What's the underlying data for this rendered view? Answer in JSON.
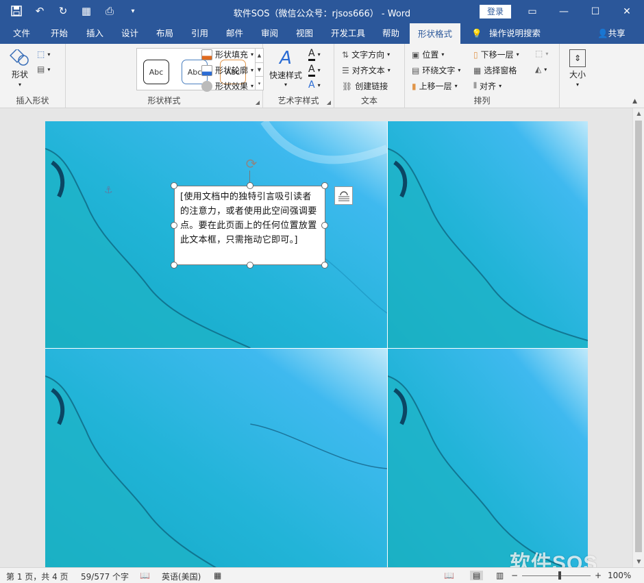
{
  "window": {
    "title": "软件SOS（微信公众号：rjsos666） - Word",
    "login_label": "登录"
  },
  "tabs": [
    "文件",
    "开始",
    "插入",
    "设计",
    "布局",
    "引用",
    "邮件",
    "审阅",
    "视图",
    "开发工具",
    "帮助",
    "形状格式"
  ],
  "active_tab": "形状格式",
  "tell_me": "操作说明搜索",
  "share": "共享",
  "ribbon": {
    "insert_shape": {
      "shape_label": "形状",
      "group_label": "插入形状"
    },
    "shape_styles": {
      "abc1": "Abc",
      "abc2": "Abc",
      "abc3": "Abc",
      "fill": "形状填充",
      "outline": "形状轮廓",
      "effect": "形状效果",
      "group_label": "形状样式"
    },
    "wordart": {
      "quick_styles": "快速样式",
      "group_label": "艺术字样式"
    },
    "text": {
      "direction": "文字方向",
      "align": "对齐文本",
      "link": "创建链接",
      "group_label": "文本"
    },
    "arrange": {
      "position": "位置",
      "wrap": "环绕文字",
      "bring_forward": "上移一层",
      "send_backward": "下移一层",
      "selection_pane": "选择窗格",
      "align": "对齐",
      "group_label": "排列"
    },
    "size": {
      "label": "大小"
    }
  },
  "document": {
    "textbox_text": "[使用文档中的独特引言吸引读者的注意力，或者使用此空间强调要点。要在此页面上的任何位置放置此文本框，只需拖动它即可。]"
  },
  "status": {
    "page": "第 1 页，共 4 页",
    "words": "59/577 个字",
    "language": "英语(美国)",
    "zoom": "100%"
  },
  "watermark": "软件SOS",
  "colors": {
    "brand": "#2b579a",
    "ribbon_bg": "#f3f3f3",
    "abc_border1": "#222222",
    "abc_border2": "#4a7fbf",
    "abc_border3": "#e0954a"
  }
}
